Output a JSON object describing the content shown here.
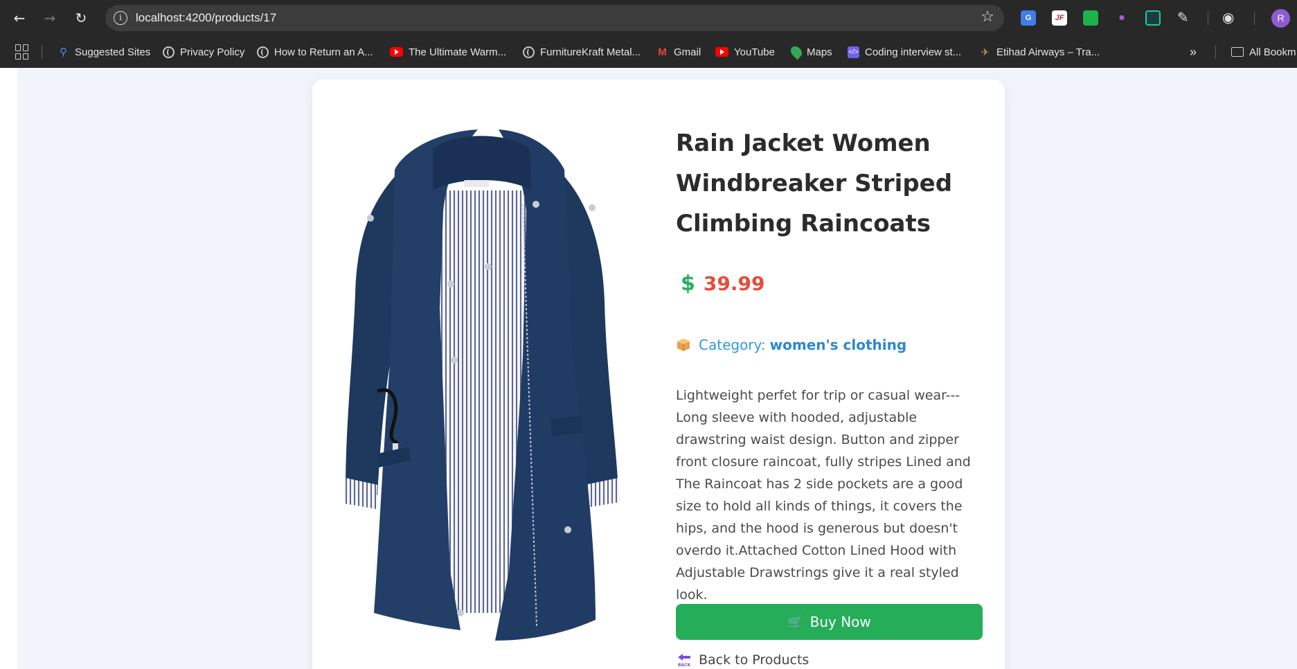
{
  "browser": {
    "url": "localhost:4200/products/17",
    "bookmarks": [
      {
        "label": "Suggested Sites",
        "icon": "search-icon"
      },
      {
        "label": "Privacy Policy",
        "icon": "globe-icon"
      },
      {
        "label": "How to Return an A...",
        "icon": "globe-icon"
      },
      {
        "label": "The Ultimate Warm...",
        "icon": "youtube-icon"
      },
      {
        "label": "FurnitureKraft Metal...",
        "icon": "globe-icon"
      },
      {
        "label": "Gmail",
        "icon": "gmail-icon"
      },
      {
        "label": "YouTube",
        "icon": "youtube-icon"
      },
      {
        "label": "Maps",
        "icon": "maps-icon"
      },
      {
        "label": "Coding interview st...",
        "icon": "code-icon"
      },
      {
        "label": "Etihad Airways – Tra...",
        "icon": "etihad-icon"
      }
    ],
    "all_bookmarks": "All Bookm",
    "avatar_initial": "R",
    "extension_labels": {
      "ext_jf": "JF",
      "ext_translate": "G"
    }
  },
  "product": {
    "title": "Rain Jacket Women Windbreaker Striped Climbing Raincoats",
    "currency_symbol": "$",
    "price": "39.99",
    "category_label": "Category:",
    "category_value": "women's clothing",
    "description": "Lightweight perfet for trip or casual wear---Long sleeve with hooded, adjustable drawstring waist design. Button and zipper front closure raincoat, fully stripes Lined and The Raincoat has 2 side pockets are a good size to hold all kinds of things, it covers the hips, and the hood is generous but doesn't overdo it.Attached Cotton Lined Hood with Adjustable Drawstrings give it a real styled look.",
    "buy_label": "Buy Now",
    "back_label": "Back to Products",
    "back_icon_text": "BACK"
  },
  "colors": {
    "price": "#e74c3c",
    "dollar": "#27ae60",
    "category": "#3498db",
    "buy_button": "#25ad5a",
    "jacket": "#1f3b63"
  }
}
